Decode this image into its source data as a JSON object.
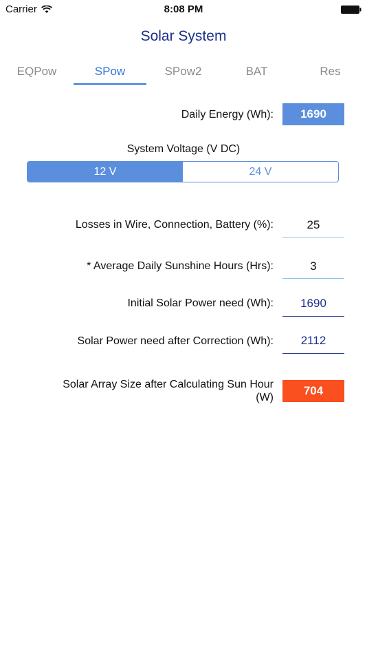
{
  "status_bar": {
    "carrier": "Carrier",
    "time": "8:08 PM",
    "wifi_icon": "wifi-icon",
    "battery_icon": "battery-icon"
  },
  "header": {
    "title": "Solar System"
  },
  "tabs": [
    {
      "label": "EQPow",
      "active": false
    },
    {
      "label": "SPow",
      "active": true
    },
    {
      "label": "SPow2",
      "active": false
    },
    {
      "label": "BAT",
      "active": false
    },
    {
      "label": "Res",
      "active": false
    }
  ],
  "daily_energy": {
    "label": "Daily Energy (Wh):",
    "value": "1690"
  },
  "system_voltage": {
    "label": "System Voltage (V DC)",
    "options": [
      "12 V",
      "24 V"
    ],
    "selected": "12 V"
  },
  "losses": {
    "label": "Losses in Wire, Connection, Battery (%):",
    "value": "25"
  },
  "sunshine_hours": {
    "label": "* Average Daily Sunshine Hours (Hrs):",
    "value": "3"
  },
  "initial_power": {
    "label": "Initial Solar Power need (Wh):",
    "value": "1690"
  },
  "corrected_power": {
    "label": "Solar Power need after Correction (Wh):",
    "value": "2112"
  },
  "array_size": {
    "label_line1": "Solar Array Size after Calculating Sun Hour",
    "label_line2": "(W)",
    "value": "704"
  },
  "colors": {
    "accent_blue": "#5b8fde",
    "tab_active": "#3478d8",
    "title_navy": "#1a2f8a",
    "result_orange": "#fa4f1e"
  }
}
